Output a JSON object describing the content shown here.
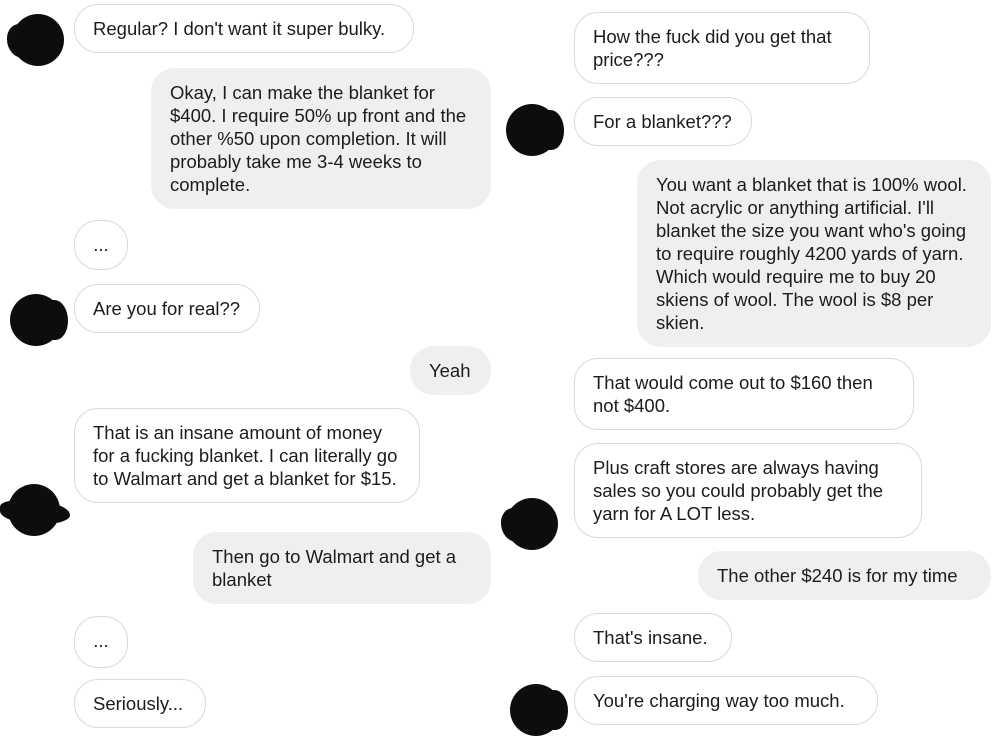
{
  "left": [
    {
      "side": "in",
      "text": "Regular? I don't want it super bulky."
    },
    {
      "side": "out",
      "text": "Okay, I can make the blanket for $400. I require 50% up front and the other %50 upon completion. It will probably take me 3-4 weeks to complete."
    },
    {
      "side": "in",
      "text": "..."
    },
    {
      "side": "in",
      "text": "Are you for real??"
    },
    {
      "side": "out",
      "text": "Yeah"
    },
    {
      "side": "in",
      "text": "That is an insane amount of money for a fucking blanket. I can literally go to Walmart and get a blanket for $15."
    },
    {
      "side": "out",
      "text": "Then go to Walmart and get a blanket"
    },
    {
      "side": "in",
      "text": "..."
    },
    {
      "side": "in",
      "text": "Seriously..."
    }
  ],
  "right": [
    {
      "side": "in",
      "text": "How the fuck did you get that price???"
    },
    {
      "side": "in",
      "text": "For a blanket???"
    },
    {
      "side": "out",
      "text": "You want a blanket that is 100% wool. Not acrylic or anything artificial. I'll blanket the size you want who's going to require roughly 4200 yards of yarn. Which would require me to buy 20 skiens of wool. The wool is $8 per skien."
    },
    {
      "side": "in",
      "text": "That would come out to $160 then not $400."
    },
    {
      "side": "in",
      "text": "Plus craft stores are always having sales so you could probably get the yarn for A LOT less."
    },
    {
      "side": "out",
      "text": "The other $240 is for my time"
    },
    {
      "side": "in",
      "text": "That's insane."
    },
    {
      "side": "in",
      "text": "You're charging way too much."
    }
  ]
}
